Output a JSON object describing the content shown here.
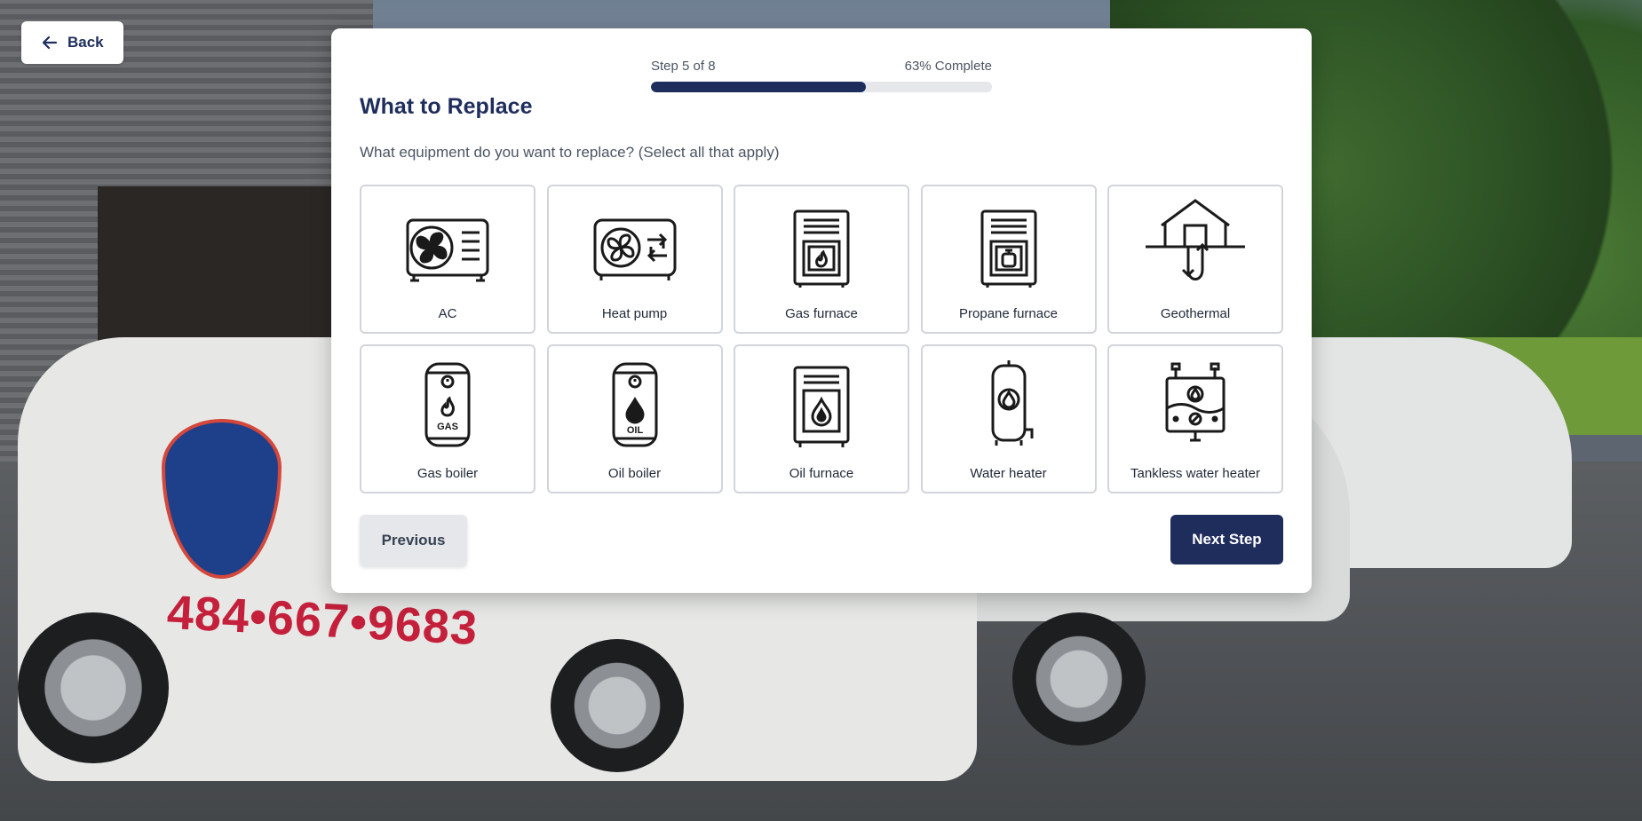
{
  "back": {
    "label": "Back",
    "icon": "arrow-left-icon"
  },
  "progress": {
    "step_text": "Step 5 of 8",
    "percent_text": "63% Complete",
    "fraction": 0.63
  },
  "page": {
    "title": "What to Replace",
    "question": "What equipment do you want to replace? (Select all that apply)"
  },
  "options": [
    {
      "label": "AC",
      "icon": "ac-unit-icon"
    },
    {
      "label": "Heat pump",
      "icon": "heat-pump-icon"
    },
    {
      "label": "Gas furnace",
      "icon": "gas-furnace-icon"
    },
    {
      "label": "Propane furnace",
      "icon": "propane-furnace-icon"
    },
    {
      "label": "Geothermal",
      "icon": "geothermal-icon"
    },
    {
      "label": "Gas boiler",
      "icon": "gas-boiler-icon"
    },
    {
      "label": "Oil boiler",
      "icon": "oil-boiler-icon"
    },
    {
      "label": "Oil furnace",
      "icon": "oil-furnace-icon"
    },
    {
      "label": "Water heater",
      "icon": "water-heater-icon"
    },
    {
      "label": "Tankless water heater",
      "icon": "tankless-water-heater-icon"
    }
  ],
  "icon_text": {
    "gas": "GAS",
    "oil": "OIL"
  },
  "buttons": {
    "previous": "Previous",
    "next": "Next Step"
  },
  "colors": {
    "brand_navy": "#1e2d5c",
    "progress_track": "#e5e7eb",
    "card_border": "#d1d5db"
  }
}
